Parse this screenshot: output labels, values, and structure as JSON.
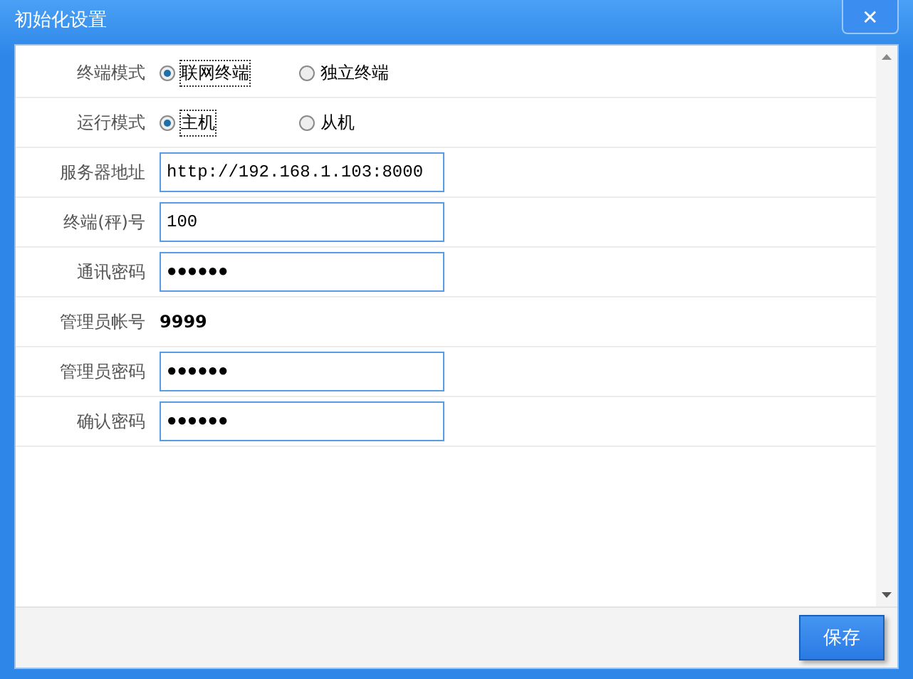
{
  "window": {
    "title": "初始化设置",
    "close": "✕"
  },
  "rows": [
    {
      "kind": "radio",
      "label": "终端模式",
      "options": [
        {
          "label": "联网终端",
          "selected": true
        },
        {
          "label": "独立终端",
          "selected": false
        }
      ]
    },
    {
      "kind": "radio",
      "label": "运行模式",
      "options": [
        {
          "label": "主机",
          "selected": true
        },
        {
          "label": "从机",
          "selected": false
        }
      ]
    },
    {
      "kind": "input",
      "label": "服务器地址",
      "value": "http://192.168.1.103:8000"
    },
    {
      "kind": "input",
      "label": "终端(秤)号",
      "value": "100"
    },
    {
      "kind": "input",
      "label": "通讯密码",
      "value": "●●●●●●"
    },
    {
      "kind": "text",
      "label": "管理员帐号",
      "value": "9999"
    },
    {
      "kind": "input",
      "label": "管理员密码",
      "value": "●●●●●●"
    },
    {
      "kind": "input",
      "label": "确认密码",
      "value": "●●●●●●"
    }
  ],
  "footer": {
    "save_button": "保存"
  }
}
